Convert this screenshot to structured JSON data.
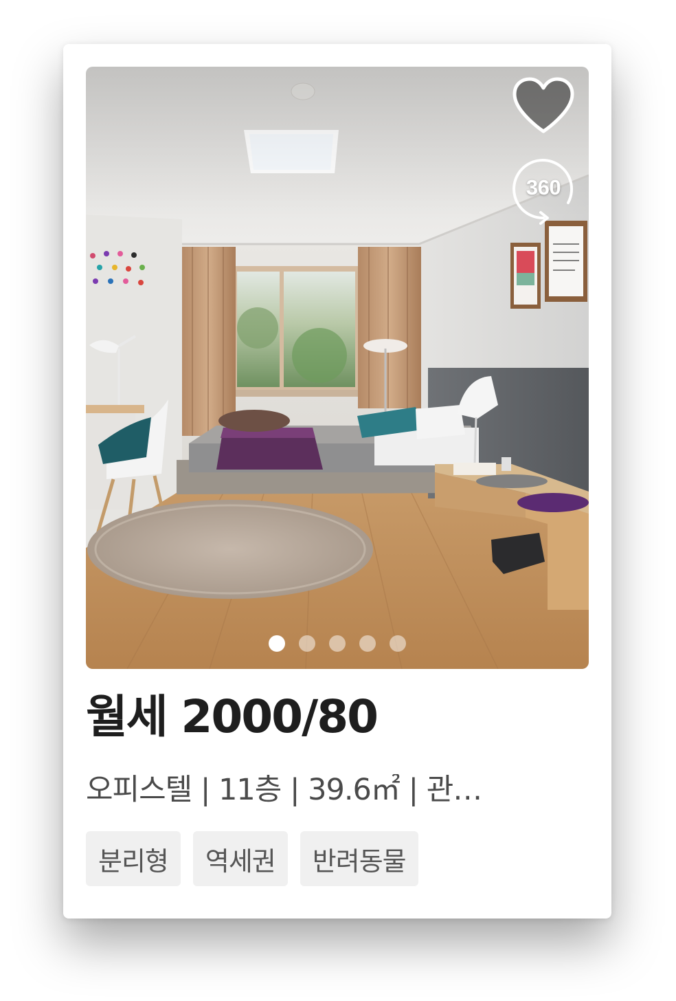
{
  "listing": {
    "price": "월세 2000/80",
    "details": "오피스텔 | 11층 | 39.6㎡ | 관…",
    "tags": [
      "분리형",
      "역세권",
      "반려동물"
    ]
  },
  "photo": {
    "view360_label": "360",
    "slides": 5,
    "active_slide": 1
  },
  "icons": {
    "favorite": "heart-icon",
    "view360": "rotate-360-icon"
  },
  "colors": {
    "title": "#1e1e1e",
    "subtitle": "#4a4a4a",
    "tag_bg": "#f0f0f0",
    "tag_text": "#555555"
  }
}
